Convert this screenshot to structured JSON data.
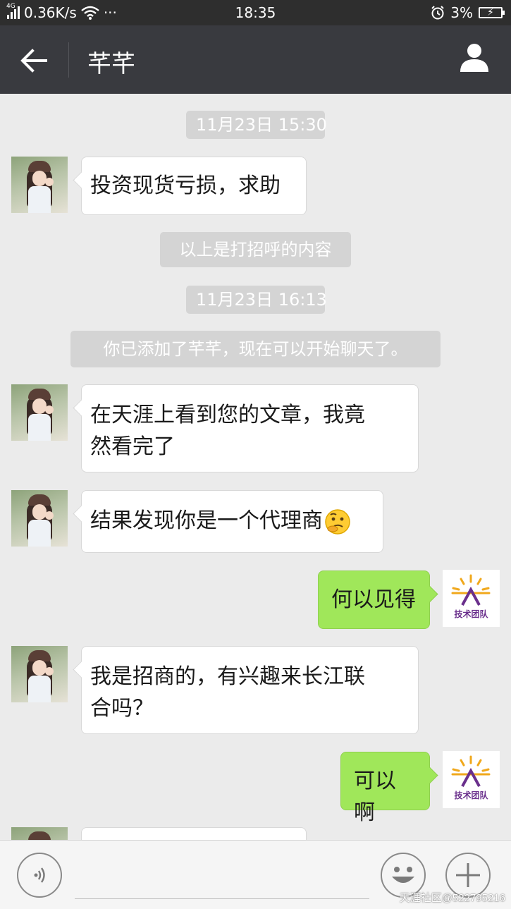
{
  "status_bar": {
    "network": "4G",
    "speed": "0.36K/s",
    "more": "···",
    "time": "18:35",
    "battery": "3%"
  },
  "header": {
    "title": "芊芊",
    "back_icon": "arrow-left-icon",
    "profile_icon": "person-icon"
  },
  "messages": {
    "time1": "11月23日 15:30",
    "m1": "投资现货亏损，求助",
    "note_greeting": "以上是打招呼的内容",
    "time2": "11月23日 16:13",
    "note_added": "你已添加了芊芊，现在可以开始聊天了。",
    "m2_line1": "在天涯上看到您的文章，我竟",
    "m2_line2": "然看完了",
    "m3": "结果发现你是一个代理商",
    "m3_emoji": "thinking-face-icon",
    "m4": "何以见得",
    "m5_line1": "我是招商的，有兴趣来长江联",
    "m5_line2": "合吗？",
    "m6": "可以啊"
  },
  "my_avatar": {
    "label": "技术团队",
    "accent": "#f0a81c",
    "brand": "#6a2f8c"
  },
  "input_bar": {
    "voice_icon": "voice-icon",
    "emoji_icon": "smiley-icon",
    "plus_icon": "plus-icon"
  },
  "watermark": "天涯社区@522795216",
  "colors": {
    "header_bg": "#393a3f",
    "chat_bg": "#ebebeb",
    "sent_bubble": "#a0e75a",
    "received_bubble": "#ffffff"
  }
}
